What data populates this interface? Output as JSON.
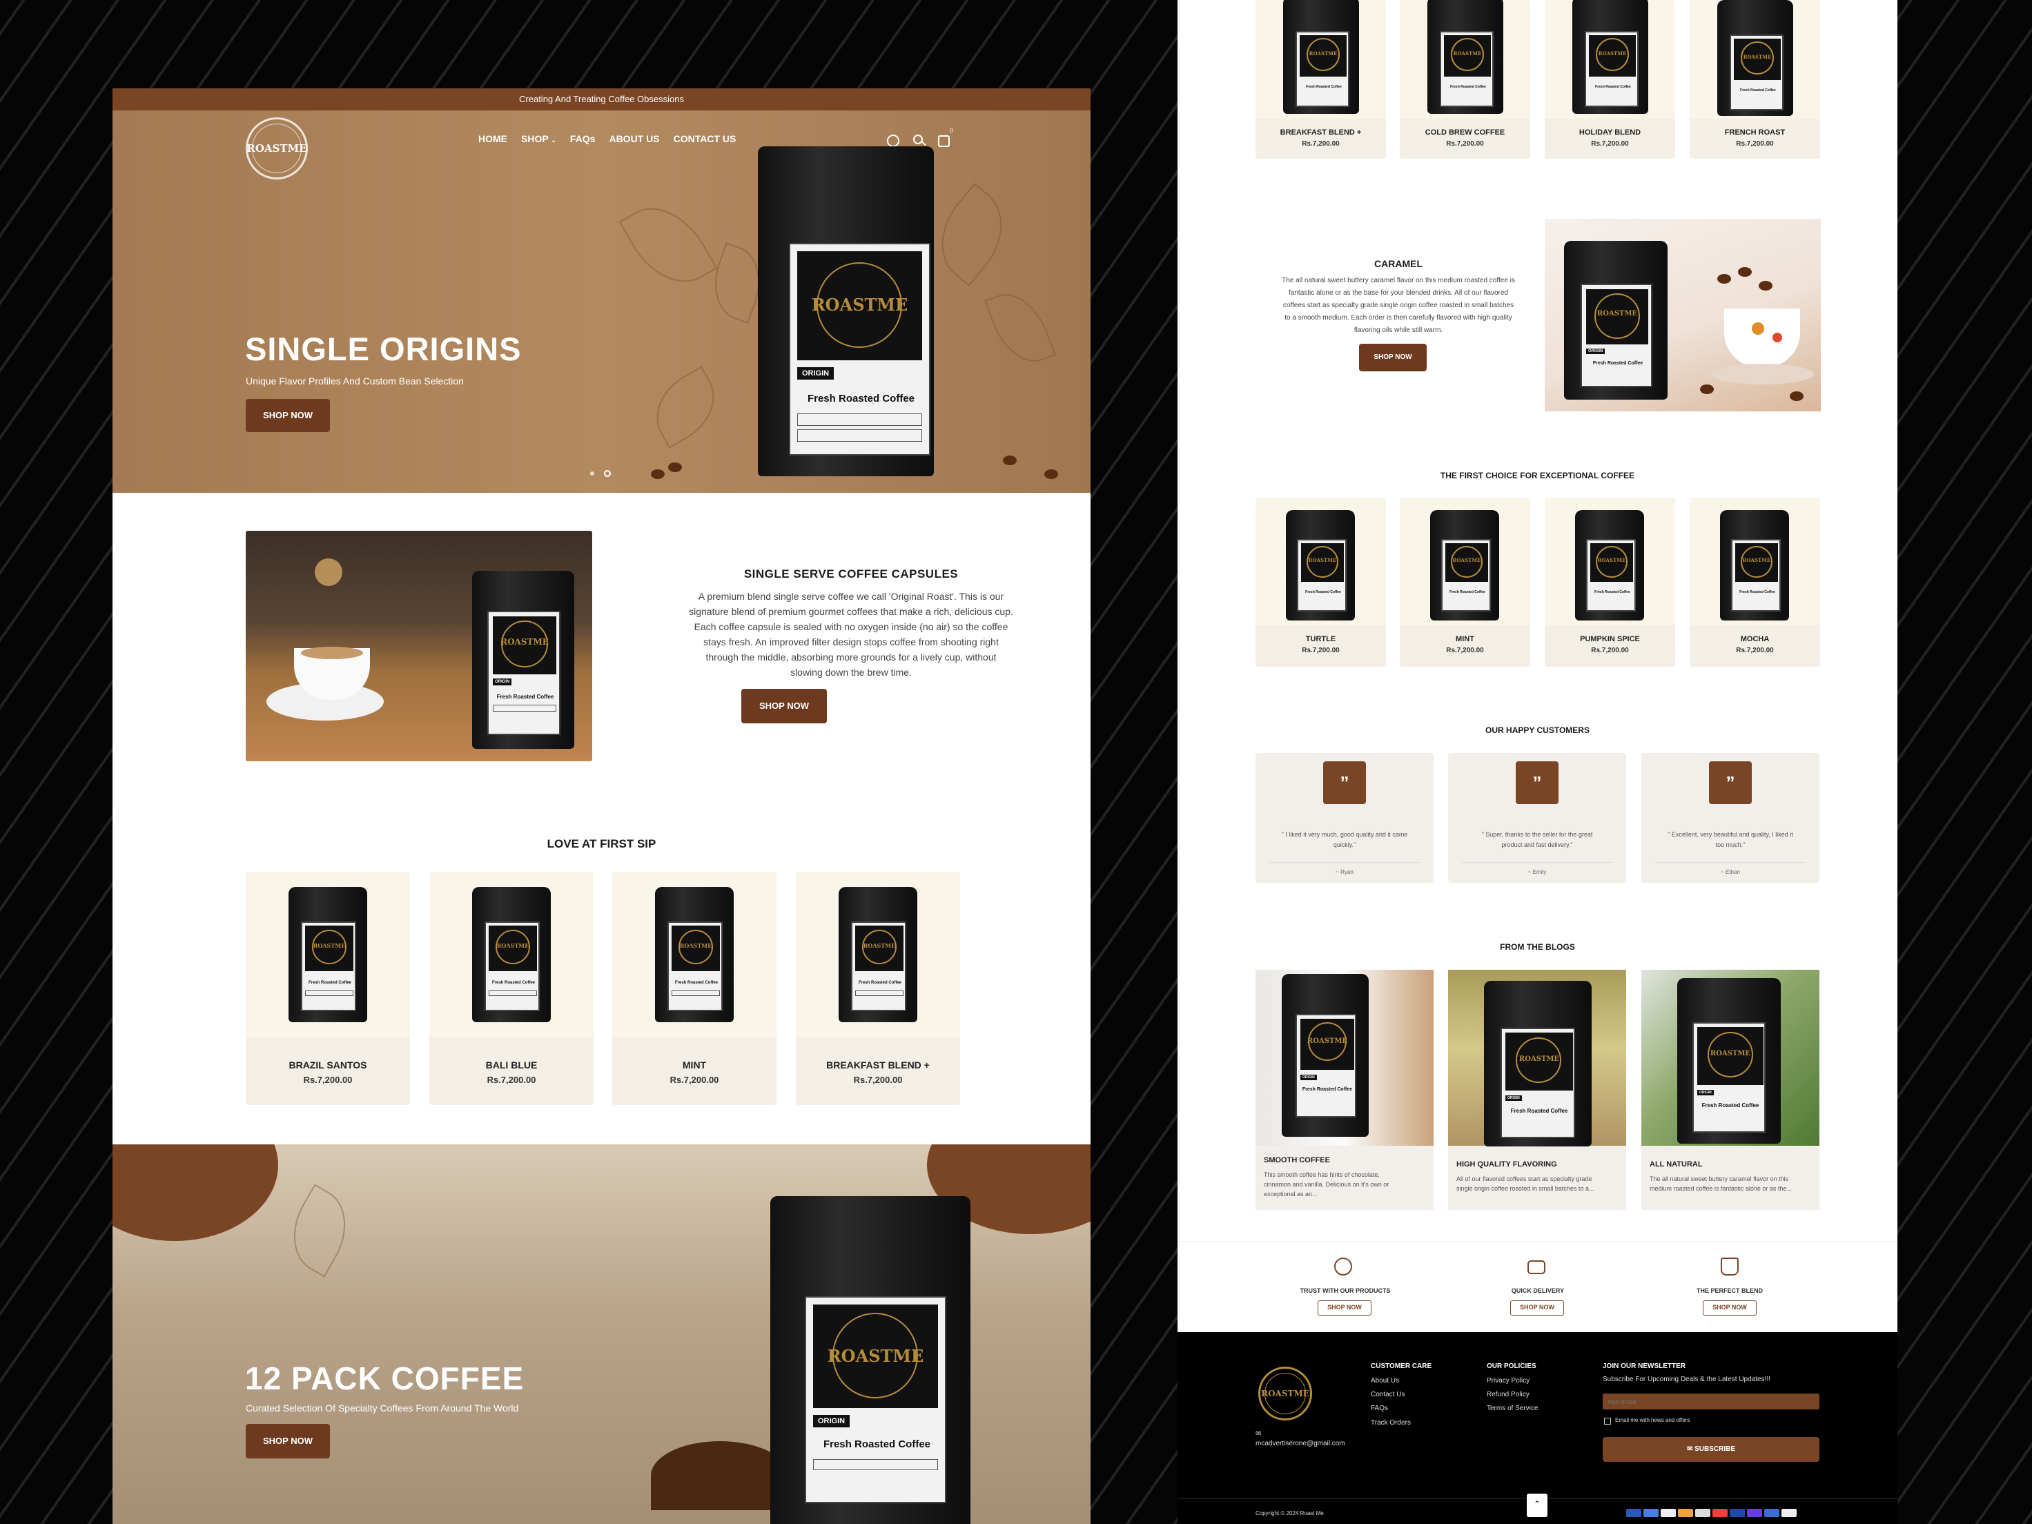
{
  "left": {
    "announcement": "Creating And Treating Coffee Obsessions",
    "logo": {
      "text": "ROASTME",
      "ring_top": "PREMIUM ROASTED",
      "ring_bottom": "PREMIUM COFFEE"
    },
    "nav": [
      "HOME",
      "SHOP",
      "FAQs",
      "ABOUT US",
      "CONTACT US"
    ],
    "cart_count": "0",
    "hero": {
      "title": "SINGLE ORIGINS",
      "subtitle": "Unique Flavor Profiles And Custom Bean Selection",
      "button": "SHOP NOW",
      "slide": 2,
      "slides": 2
    },
    "bag_label": {
      "brand": "ROASTME",
      "origin": "ORIGIN",
      "product": "Fresh Roasted Coffee"
    },
    "capsules": {
      "title": "SINGLE SERVE COFFEE CAPSULES",
      "text_lines": [
        "A premium blend single serve coffee we call 'Original Roast'. This is our",
        "signature blend of premium gourmet coffees that make a rich, delicious cup.",
        "Each coffee capsule is sealed with no oxygen inside (no air) so the coffee",
        "stays fresh. An improved filter design stops coffee from shooting right",
        "through the middle, absorbing more grounds for a lively cup, without",
        "slowing down the brew time."
      ],
      "button": "SHOP NOW"
    },
    "love": {
      "title": "LOVE AT FIRST SIP",
      "products": [
        {
          "name": "BRAZIL SANTOS",
          "price": "Rs.7,200.00"
        },
        {
          "name": "BALI BLUE",
          "price": "Rs.7,200.00"
        },
        {
          "name": "MINT",
          "price": "Rs.7,200.00"
        },
        {
          "name": "BREAKFAST BLEND +",
          "price": "Rs.7,200.00"
        }
      ]
    },
    "pack": {
      "title": "12 PACK COFFEE",
      "subtitle": "Curated Selection Of Specialty Coffees From Around The World",
      "button": "SHOP NOW"
    }
  },
  "right": {
    "top_products": [
      {
        "name": "BREAKFAST BLEND +",
        "price": "Rs.7,200.00"
      },
      {
        "name": "COLD BREW COFFEE",
        "price": "Rs.7,200.00"
      },
      {
        "name": "HOLIDAY BLEND",
        "price": "Rs.7,200.00"
      },
      {
        "name": "FRENCH ROAST",
        "price": "Rs.7,200.00"
      }
    ],
    "caramel": {
      "title": "CARAMEL",
      "text_lines": [
        "The all natural sweet buttery caramel flavor on this medium roasted coffee is",
        "fantastic alone or as the base for your blended drinks. All of our flavored",
        "coffees start as specialty grade single origin coffee roasted in small batches",
        "to a smooth medium. Each order is then carefully flavored with high quality",
        "flavoring oils while still warm."
      ],
      "button": "SHOP NOW"
    },
    "first_choice": {
      "title": "THE FIRST CHOICE FOR EXCEPTIONAL COFFEE",
      "products": [
        {
          "name": "TURTLE",
          "price": "Rs.7,200.00"
        },
        {
          "name": "MINT",
          "price": "Rs.7,200.00"
        },
        {
          "name": "PUMPKIN SPICE",
          "price": "Rs.7,200.00"
        },
        {
          "name": "MOCHA",
          "price": "Rs.7,200.00"
        }
      ]
    },
    "testimonials": {
      "title": "OUR HAPPY CUSTOMERS",
      "items": [
        {
          "quote1": "\" I liked it very much, good quality and it came",
          "quote2": "quickly.\"",
          "author": "~ Ryan"
        },
        {
          "quote1": "\" Super, thanks to the seller for the great",
          "quote2": "product and fast delivery.\"",
          "author": "~ Emily"
        },
        {
          "quote1": "\" Excellent, very beautiful and quality, I liked it",
          "quote2": "too much.\"",
          "author": "~ Ethan"
        }
      ]
    },
    "blogs": {
      "title": "FROM THE BLOGS",
      "items": [
        {
          "title": "SMOOTH COFFEE",
          "line1": "This smooth coffee has hints of chocolate,",
          "line2": "cinnamon and vanilla. Delicious on it's own or",
          "line3": "exceptional as an..."
        },
        {
          "title": "HIGH QUALITY FLAVORING",
          "line1": "All of our flavored coffees start as specialty grade",
          "line2": "single origin coffee roasted in small batches to a...",
          "line3": ""
        },
        {
          "title": "ALL NATURAL",
          "line1": "The all natural sweet buttery caramel flavor on this",
          "line2": "medium roasted coffee is fantastic alone or as the...",
          "line3": ""
        }
      ]
    },
    "features": [
      {
        "label": "TRUST WITH OUR PRODUCTS",
        "button": "SHOP NOW"
      },
      {
        "label": "QUICK DELIVERY",
        "button": "SHOP NOW"
      },
      {
        "label": "THE PERFECT BLEND",
        "button": "SHOP NOW"
      }
    ],
    "footer": {
      "email": "mcadvertiserone@gmail.com",
      "customer_care": {
        "title": "CUSTOMER CARE",
        "links": [
          "About Us",
          "Contact Us",
          "FAQs",
          "Track Orders"
        ]
      },
      "policies": {
        "title": "OUR POLICIES",
        "links": [
          "Privacy Policy",
          "Refund Policy",
          "Terms of Service"
        ]
      },
      "newsletter": {
        "title": "JOIN OUR NEWSLETTER",
        "subtitle": "Subscribe For Upcoming Deals & the Latest Updates!!!",
        "placeholder": "Your email",
        "consent": "Email me with news and offers",
        "button": "SUBSCRIBE"
      },
      "copyright": "Copyright © 2024 Roast Me"
    }
  },
  "colors": {
    "brand_brown": "#7a4524",
    "dark_button": "#6d3a1f",
    "hero_tan": "#a47a52",
    "card_cream": "#f3efe6"
  }
}
